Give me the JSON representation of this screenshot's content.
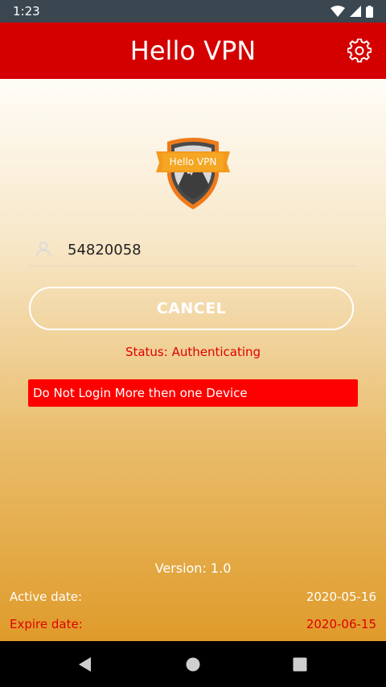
{
  "status_bar": {
    "time": "1:23"
  },
  "app_bar": {
    "title": "Hello VPN"
  },
  "logo": {
    "text": "Hello VPN"
  },
  "login": {
    "username_value": "54820058"
  },
  "cancel_button": {
    "label": "CANCEL"
  },
  "status": {
    "text": "Status: Authenticating"
  },
  "warning": {
    "text": "Do Not Login More then one Device"
  },
  "version": {
    "text": "Version: 1.0"
  },
  "active": {
    "label": "Active date:",
    "value": "2020-05-16"
  },
  "expire": {
    "label": "Expire date:",
    "value": "2020-06-15"
  },
  "colors": {
    "appbar": "#d40000",
    "status_red": "#e00000",
    "warning_bg": "#ff0000",
    "gradient_bottom": "#df9b2a"
  }
}
